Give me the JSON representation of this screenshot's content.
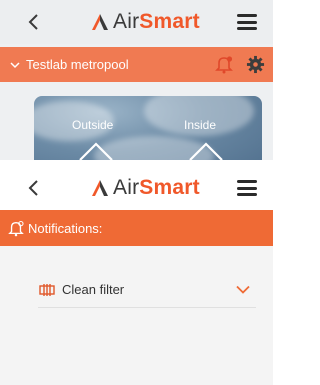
{
  "brand": {
    "air": "Air",
    "smart": "Smart",
    "accent": "#f0582a"
  },
  "background_screen": {
    "location": "Testlab metropool",
    "weather": {
      "outside_label": "Outside",
      "inside_label": "Inside"
    },
    "icons": [
      "chevron-down-icon",
      "bell-icon",
      "gear-icon",
      "house-icon"
    ]
  },
  "foreground_screen": {
    "header_title": "Notifications:",
    "notifications": [
      {
        "label": "Clean filter",
        "icon": "filter-icon"
      }
    ]
  },
  "colors": {
    "location_bar": "#f07a52",
    "notification_bar": "#ef6a35",
    "text_dark": "#333333"
  }
}
